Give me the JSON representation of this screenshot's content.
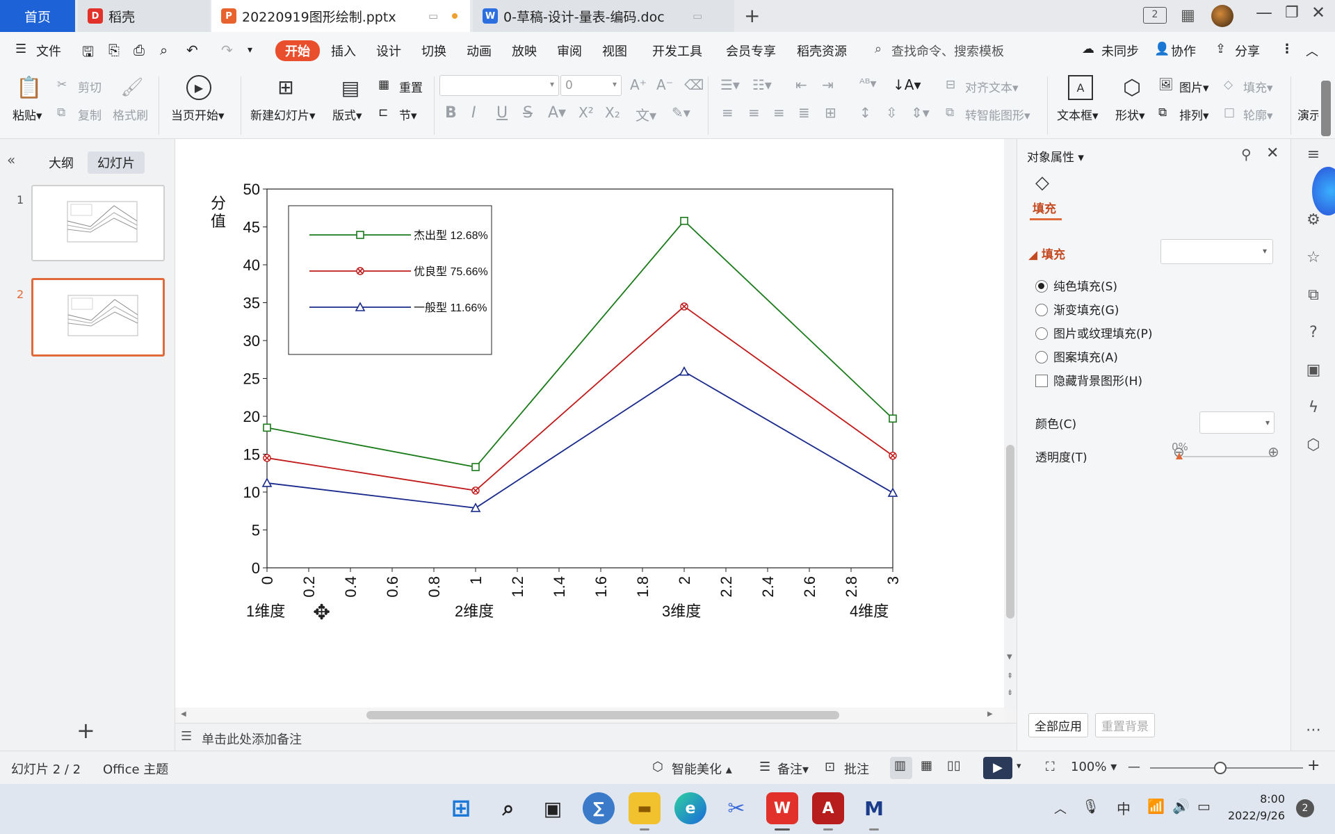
{
  "tabs": {
    "home": "首页",
    "daoke": "稻壳",
    "pptx": "20220919图形绘制.pptx",
    "doc": "0-草稿-设计-量表-编码.doc"
  },
  "menu": {
    "file": "文件",
    "items": [
      "开始",
      "插入",
      "设计",
      "切换",
      "动画",
      "放映",
      "审阅",
      "视图",
      "开发工具",
      "会员专享",
      "稻壳资源"
    ],
    "search_placeholder": "查找命令、搜索模板",
    "unsync": "未同步",
    "collab": "协作",
    "share": "分享"
  },
  "ribbon": {
    "paste": "粘贴",
    "cut": "剪切",
    "copy": "复制",
    "format_painter": "格式刷",
    "start_current": "当页开始",
    "new_slide": "新建幻灯片",
    "layout": "版式",
    "reset": "重置",
    "section": "节",
    "font_size": "0",
    "align_text": "对齐文本",
    "smart_shape": "转智能图形",
    "textbox": "文本框",
    "shape": "形状",
    "picture": "图片",
    "arrange": "排列",
    "fill": "填充",
    "outline": "轮廓",
    "present": "演示"
  },
  "left_panel": {
    "outline_tab": "大纲",
    "slides_tab": "幻灯片",
    "slide_numbers": [
      "1",
      "2"
    ],
    "add_symbol": "+"
  },
  "notes_placeholder": "单击此处添加备注",
  "right_panel": {
    "title": "对象属性",
    "fill_tab": "填充",
    "fill_section": "填充",
    "options": [
      "纯色填充(S)",
      "渐变填充(G)",
      "图片或纹理填充(P)",
      "图案填充(A)"
    ],
    "hide_bg": "隐藏背景图形(H)",
    "color_label": "颜色(C)",
    "transparency_label": "透明度(T)",
    "transparency_value": "0%",
    "apply_all": "全部应用",
    "reset_bg": "重置背景"
  },
  "status": {
    "slide_info": "幻灯片 2 / 2",
    "theme": "Office 主题",
    "beautify": "智能美化",
    "notes": "备注",
    "comments": "批注",
    "zoom": "100%"
  },
  "taskbar": {
    "ime": "中",
    "time": "8:00",
    "date": "2022/9/26",
    "notif_count": "2"
  },
  "chart_data": {
    "type": "line",
    "ylabel": "分值",
    "ylim": [
      0,
      50
    ],
    "yticks": [
      0,
      5,
      10,
      15,
      20,
      25,
      30,
      35,
      40,
      45,
      50
    ],
    "xlim": [
      0,
      3
    ],
    "xticks": [
      "0",
      "0.2",
      "0.4",
      "0.6",
      "0.8",
      "1",
      "1.2",
      "1.4",
      "1.6",
      "1.8",
      "2",
      "2.2",
      "2.4",
      "2.6",
      "2.8",
      "3"
    ],
    "category_labels": [
      "1维度",
      "2维度",
      "3维度",
      "4维度"
    ],
    "x": [
      0,
      1,
      2,
      3
    ],
    "series": [
      {
        "name": "杰出型 12.68%",
        "color": "#1a7a1a",
        "marker": "square",
        "values": [
          18.5,
          13.3,
          45.8,
          19.7
        ]
      },
      {
        "name": "优良型 75.66%",
        "color": "#c01a1a",
        "marker": "x",
        "values": [
          14.5,
          10.2,
          34.5,
          14.8
        ]
      },
      {
        "name": "一般型 11.66%",
        "color": "#1a2a8a",
        "marker": "triangle",
        "values": [
          11.2,
          7.9,
          25.9,
          9.9
        ]
      }
    ],
    "legend": "top-left",
    "grid": false
  }
}
